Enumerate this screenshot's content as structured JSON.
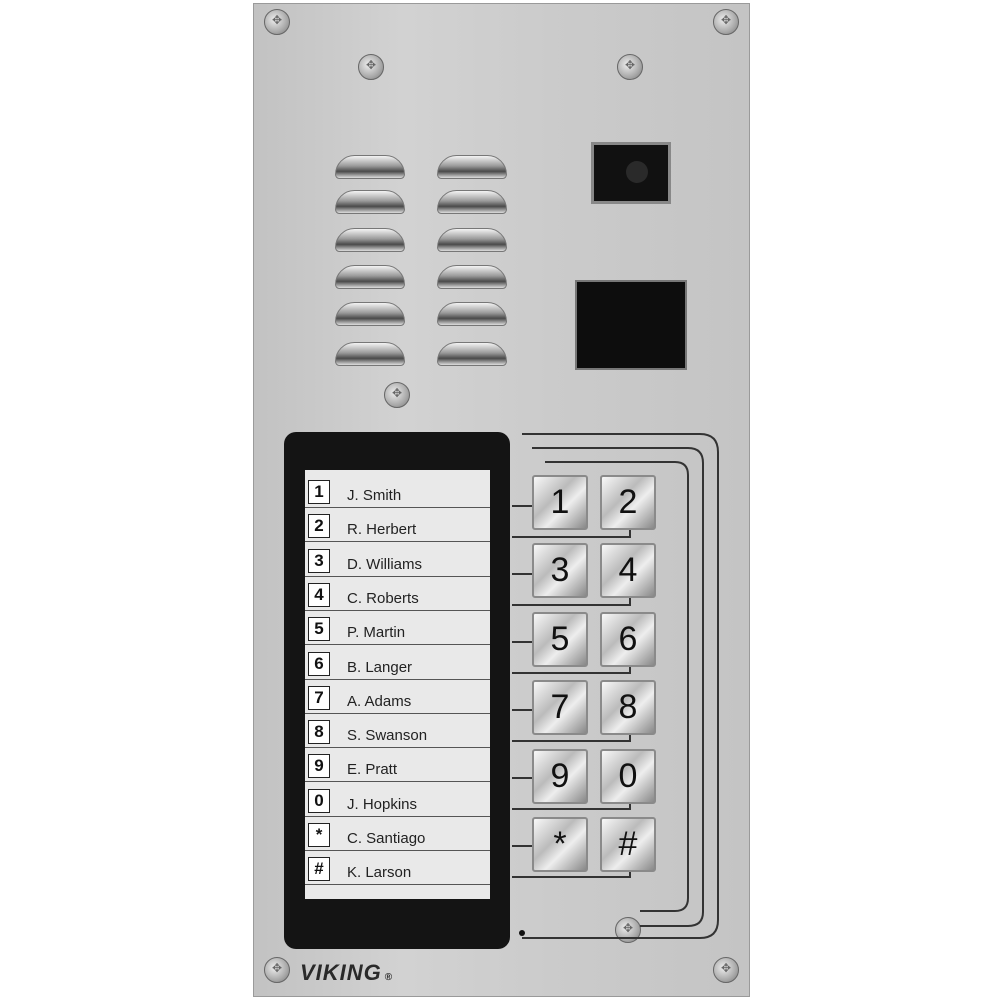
{
  "brand": {
    "logo": "VIKING",
    "mark": "®"
  },
  "directory": [
    {
      "key": "1",
      "name": "J. Smith"
    },
    {
      "key": "2",
      "name": "R. Herbert"
    },
    {
      "key": "3",
      "name": "D. Williams"
    },
    {
      "key": "4",
      "name": "C. Roberts"
    },
    {
      "key": "5",
      "name": "P. Martin"
    },
    {
      "key": "6",
      "name": "B. Langer"
    },
    {
      "key": "7",
      "name": "A. Adams"
    },
    {
      "key": "8",
      "name": "S. Swanson"
    },
    {
      "key": "9",
      "name": "E. Pratt"
    },
    {
      "key": "0",
      "name": "J. Hopkins"
    },
    {
      "key": "*",
      "name": "C. Santiago"
    },
    {
      "key": "#",
      "name": "K. Larson"
    }
  ],
  "keypad": [
    "1",
    "2",
    "3",
    "4",
    "5",
    "6",
    "7",
    "8",
    "9",
    "0",
    "*",
    "#"
  ],
  "colors": {
    "panel": "#cbcbcb",
    "bezel": "#141414",
    "card": "#e9e9e9"
  }
}
